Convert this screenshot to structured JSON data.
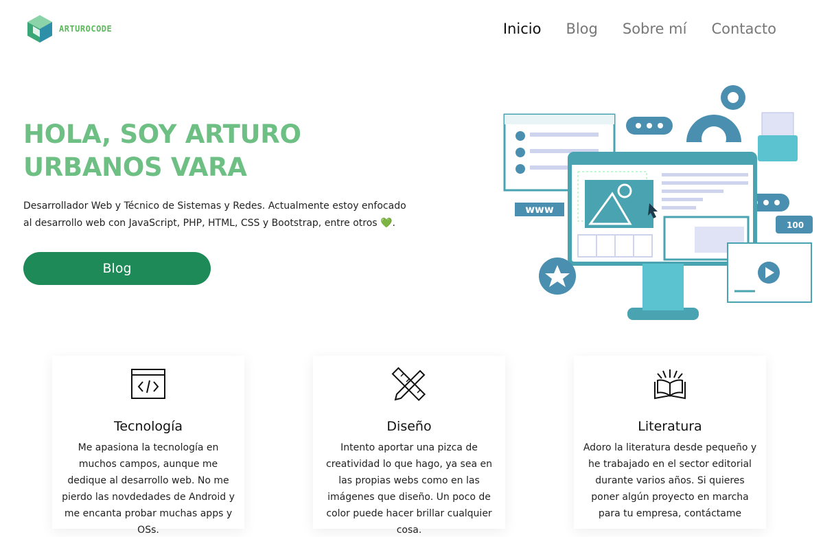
{
  "brand": {
    "name": "ARTUROCODE",
    "color": "#5cb85c"
  },
  "nav": {
    "items": [
      {
        "label": "Inicio",
        "active": true
      },
      {
        "label": "Blog",
        "active": false
      },
      {
        "label": "Sobre mí",
        "active": false
      },
      {
        "label": "Contacto",
        "active": false
      }
    ]
  },
  "hero": {
    "title_line1": "HOLA, SOY ARTURO",
    "title_line2": "URBANOS VARA",
    "description": "Desarrollador Web y Técnico de Sistemas y Redes. Actualmente estoy enfocado al desarrollo web con JavaScript, PHP, HTML, CSS y Bootstrap, entre otros",
    "heart": "💚",
    "period": ".",
    "button_label": "Blog",
    "illustration_icons": {
      "badge": "100",
      "www": "www"
    },
    "title_color": "#6dbf84",
    "button_color": "#1d8a57"
  },
  "cards": [
    {
      "icon": "code-window-icon",
      "title": "Tecnología",
      "text": "Me apasiona la tecnología en muchos campos, aunque me dedique al desarrollo web. No me pierdo las novdedades de Android y me encanta probar muchas apps y OSs."
    },
    {
      "icon": "pencil-ruler-icon",
      "title": "Diseño",
      "text": "Intento aportar una pizca de creatividad lo que hago, ya sea en las propias webs como en las imágenes que diseño. Un poco de color puede hacer brillar cualquier cosa."
    },
    {
      "icon": "open-book-icon",
      "title": "Literatura",
      "text": "Adoro la literatura desde pequeño y he trabajado en el sector editorial durante varios años. Si quieres poner algún proyecto en marcha para tu empresa, contáctame"
    }
  ]
}
